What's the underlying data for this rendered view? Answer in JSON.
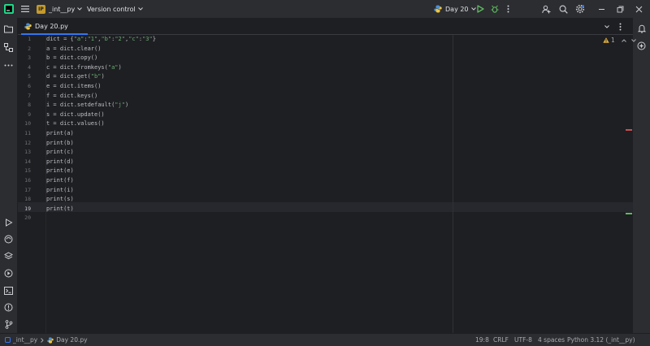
{
  "titlebar": {
    "project_badge": "IP",
    "project_name": "_int__py",
    "vcs_label": "Version control",
    "run_config": "Day 20"
  },
  "tab": {
    "label": "Day 20.py"
  },
  "editor": {
    "warning_count": "1",
    "lines": [
      {
        "n": "1",
        "code": "dict = {\"a\":\"1\",\"b\":\"2\",\"c\":\"3\"}"
      },
      {
        "n": "2",
        "code": "a = dict.clear()"
      },
      {
        "n": "3",
        "code": "b = dict.copy()"
      },
      {
        "n": "4",
        "code": "c = dict.fromkeys(\"a\")"
      },
      {
        "n": "5",
        "code": "d = dict.get(\"b\")"
      },
      {
        "n": "6",
        "code": "e = dict.items()"
      },
      {
        "n": "7",
        "code": "f = dict.keys()"
      },
      {
        "n": "8",
        "code": "i = dict.setdefault(\"j\")"
      },
      {
        "n": "9",
        "code": "s = dict.update()"
      },
      {
        "n": "10",
        "code": "t = dict.values()"
      },
      {
        "n": "11",
        "code": "print(a)"
      },
      {
        "n": "12",
        "code": "print(b)"
      },
      {
        "n": "13",
        "code": "print(c)"
      },
      {
        "n": "14",
        "code": "print(d)"
      },
      {
        "n": "15",
        "code": "print(e)"
      },
      {
        "n": "16",
        "code": "print(f)"
      },
      {
        "n": "17",
        "code": "print(i)"
      },
      {
        "n": "18",
        "code": "print(s)"
      },
      {
        "n": "19",
        "code": "print(t)"
      },
      {
        "n": "20",
        "code": ""
      }
    ]
  },
  "statusbar": {
    "project": "_int__py",
    "file": "Day 20.py",
    "position": "19:8",
    "line_sep": "CRLF",
    "encoding": "UTF-8",
    "indent": "4 spaces",
    "interpreter": "Python 3.12 (_int__py)"
  },
  "colors": {
    "accent": "#3574f0",
    "string": "#6aab73",
    "run": "#5fb85f",
    "error_mark": "#c94f4f"
  }
}
